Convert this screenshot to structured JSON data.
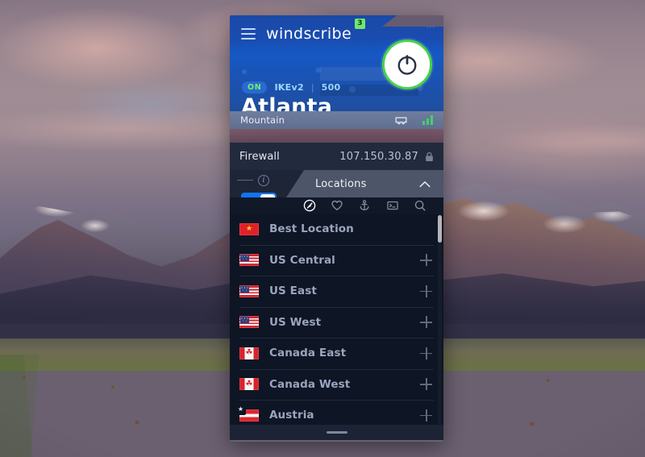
{
  "app": {
    "brand": "windscribe",
    "notification_count": "3",
    "close_label": "⋯"
  },
  "connection": {
    "state_badge": "ON",
    "protocol": "IKEv2",
    "port": "500",
    "separator": "|",
    "city": "Atlanta",
    "region": "Mountain"
  },
  "firewall": {
    "label": "Firewall",
    "ip_address": "107.150.30.87",
    "info_symbol": "i",
    "toggle_state": "on"
  },
  "locations_panel": {
    "title": "Locations",
    "tabs": [
      {
        "name": "all-locations",
        "icon": "compass-icon",
        "active": true
      },
      {
        "name": "favourites",
        "icon": "heart-icon",
        "active": false
      },
      {
        "name": "static-ips",
        "icon": "anchor-icon",
        "active": false
      },
      {
        "name": "config-files",
        "icon": "terminal-icon",
        "active": false
      },
      {
        "name": "search",
        "icon": "search-icon",
        "active": false
      }
    ],
    "rows": [
      {
        "label": "Best Location",
        "flag": "best",
        "expandable": false,
        "favourite": false
      },
      {
        "label": "US Central",
        "flag": "us",
        "expandable": true,
        "favourite": false
      },
      {
        "label": "US East",
        "flag": "us",
        "expandable": true,
        "favourite": false
      },
      {
        "label": "US West",
        "flag": "us",
        "expandable": true,
        "favourite": false
      },
      {
        "label": "Canada East",
        "flag": "ca",
        "expandable": true,
        "favourite": false
      },
      {
        "label": "Canada West",
        "flag": "ca",
        "expandable": true,
        "favourite": false
      },
      {
        "label": "Austria",
        "flag": "at",
        "expandable": true,
        "favourite": true
      }
    ]
  },
  "colors": {
    "header_blue": "#1558c4",
    "accent_green": "#45d445",
    "toggle_blue": "#1373f0",
    "badge_green": "#6ee86e",
    "list_bg": "#0e1524",
    "signal_green": "#43d16a"
  }
}
